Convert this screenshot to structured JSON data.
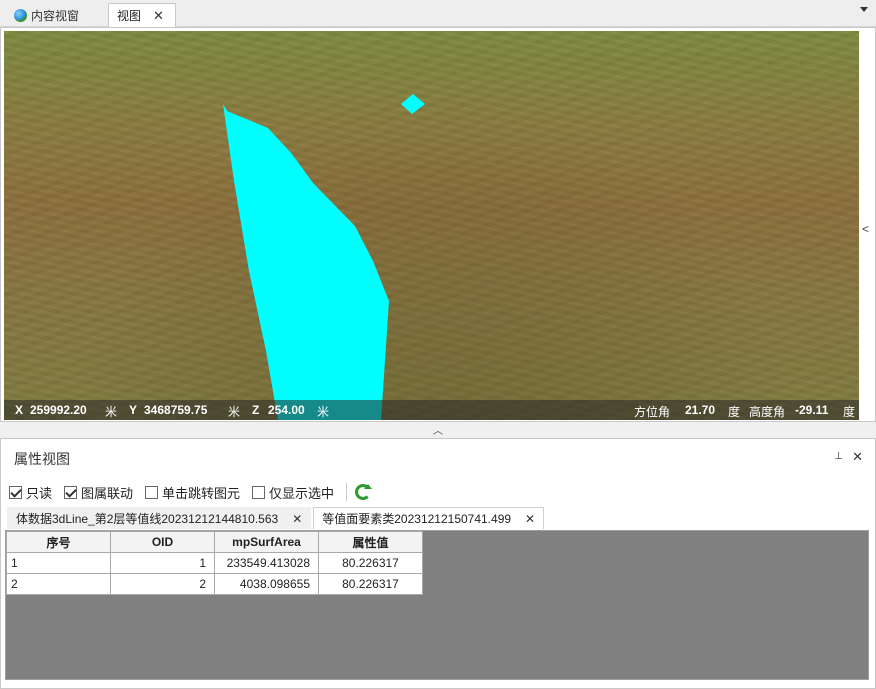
{
  "tabs": [
    {
      "label": "内容视窗",
      "icon": "globe-icon"
    },
    {
      "label": "视图",
      "close": "✕"
    }
  ],
  "statusbar": {
    "x_label": "X",
    "x_value": "259992.20",
    "x_unit": "米",
    "y_label": "Y",
    "y_value": "3468759.75",
    "y_unit": "米",
    "z_label": "Z",
    "z_value": "254.00",
    "z_unit": "米",
    "azimuth_label": "方位角",
    "azimuth_value": "21.70",
    "azimuth_unit": "度",
    "elevation_label": "高度角",
    "elevation_value": "-29.11",
    "elevation_unit": "度"
  },
  "panel": {
    "title": "属性视图",
    "pin": "⊥",
    "close": "✕"
  },
  "toolbar": {
    "readonly": {
      "label": "只读",
      "checked": true
    },
    "link": {
      "label": "图属联动",
      "checked": true
    },
    "single_jump": {
      "label": "单击跳转图元",
      "checked": false
    },
    "show_selected": {
      "label": "仅显示选中",
      "checked": false
    }
  },
  "subtabs": [
    {
      "label": "体数据3dLine_第2层等值线20231212144810.563",
      "close": "✕"
    },
    {
      "label": "等值面要素类20231212150741.499",
      "close": "✕"
    }
  ],
  "table": {
    "columns": [
      "序号",
      "OID",
      "mpSurfArea",
      "属性值"
    ],
    "rows": [
      [
        "1",
        "1",
        "233549.413028",
        "80.226317"
      ],
      [
        "2",
        "2",
        "4038.098655",
        "80.226317"
      ]
    ]
  },
  "colors": {
    "polygon_fill": "#00ffff",
    "terrain": "#8b723d",
    "refresh_icon": "#2e9b2e"
  }
}
